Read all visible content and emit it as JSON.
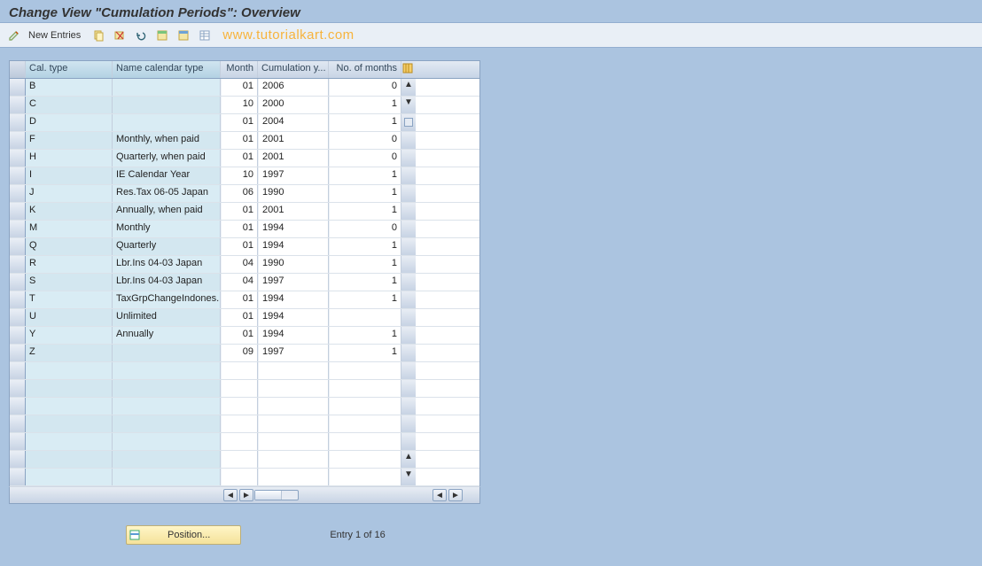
{
  "title": "Change View \"Cumulation Periods\": Overview",
  "toolbar": {
    "new_entries": "New Entries",
    "watermark": "www.tutorialkart.com"
  },
  "grid": {
    "headers": {
      "cal_type": "Cal. type",
      "name": "Name calendar type",
      "month": "Month",
      "cum_year": "Cumulation y...",
      "no_months": "No. of months"
    },
    "rows": [
      {
        "cal_type": "B",
        "name": "",
        "month": "01",
        "year": "2006",
        "no_months": "0"
      },
      {
        "cal_type": "C",
        "name": "",
        "month": "10",
        "year": "2000",
        "no_months": "1"
      },
      {
        "cal_type": "D",
        "name": "",
        "month": "01",
        "year": "2004",
        "no_months": "1"
      },
      {
        "cal_type": "F",
        "name": "Monthly, when paid",
        "month": "01",
        "year": "2001",
        "no_months": "0"
      },
      {
        "cal_type": "H",
        "name": "Quarterly, when paid",
        "month": "01",
        "year": "2001",
        "no_months": "0"
      },
      {
        "cal_type": "I",
        "name": "IE Calendar Year",
        "month": "10",
        "year": "1997",
        "no_months": "1"
      },
      {
        "cal_type": "J",
        "name": "Res.Tax 06-05  Japan",
        "month": "06",
        "year": "1990",
        "no_months": "1"
      },
      {
        "cal_type": "K",
        "name": "Annually, when paid",
        "month": "01",
        "year": "2001",
        "no_months": "1"
      },
      {
        "cal_type": "M",
        "name": "Monthly",
        "month": "01",
        "year": "1994",
        "no_months": "0"
      },
      {
        "cal_type": "Q",
        "name": "Quarterly",
        "month": "01",
        "year": "1994",
        "no_months": "1"
      },
      {
        "cal_type": "R",
        "name": "Lbr.Ins 04-03  Japan",
        "month": "04",
        "year": "1990",
        "no_months": "1"
      },
      {
        "cal_type": "S",
        "name": "Lbr.Ins 04-03  Japan",
        "month": "04",
        "year": "1997",
        "no_months": "1"
      },
      {
        "cal_type": "T",
        "name": "TaxGrpChangeIndones.",
        "month": "01",
        "year": "1994",
        "no_months": "1"
      },
      {
        "cal_type": "U",
        "name": "Unlimited",
        "month": "01",
        "year": "1994",
        "no_months": ""
      },
      {
        "cal_type": "Y",
        "name": "Annually",
        "month": "01",
        "year": "1994",
        "no_months": "1"
      },
      {
        "cal_type": "Z",
        "name": "",
        "month": "09",
        "year": "1997",
        "no_months": "1"
      }
    ]
  },
  "footer": {
    "position_label": "Position...",
    "entry_text": "Entry 1 of 16"
  }
}
